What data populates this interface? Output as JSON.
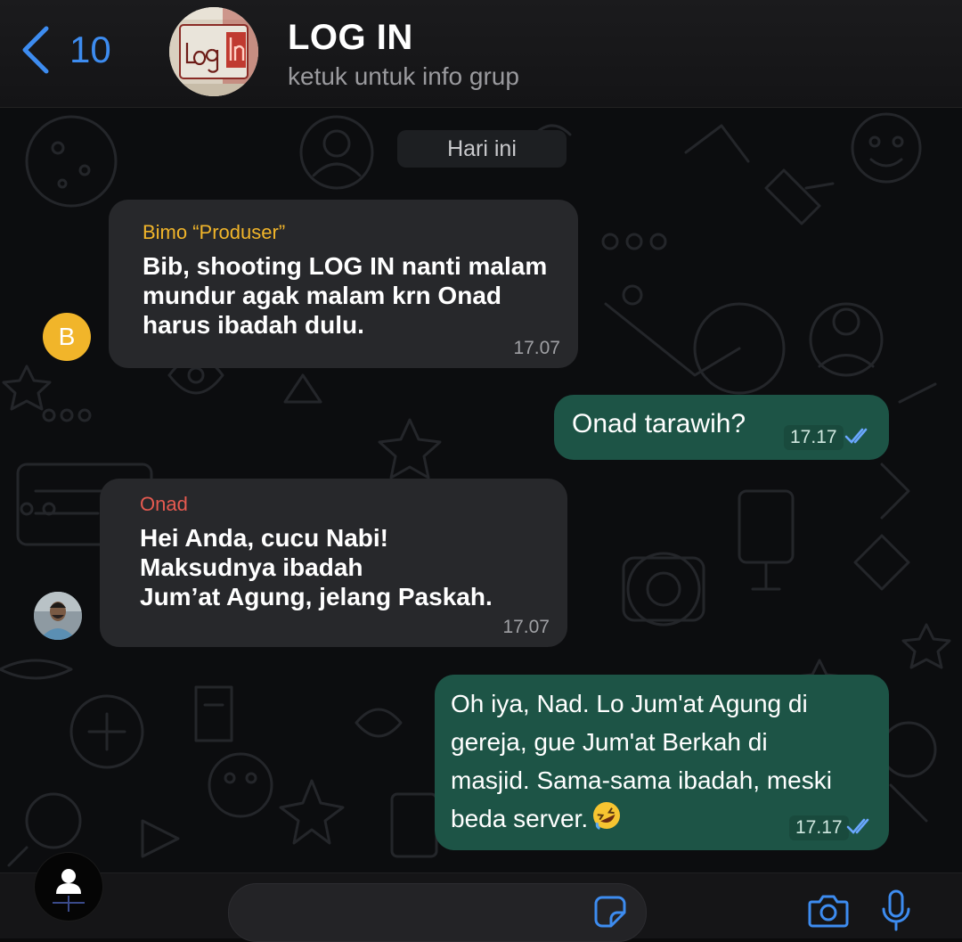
{
  "header": {
    "back_count": "10",
    "group_name": "LOG IN",
    "group_subtitle": "ketuk untuk info grup",
    "group_avatar_text": "Log In"
  },
  "chat": {
    "day_label": "Hari ini",
    "messages": [
      {
        "direction": "in",
        "sender": "Bimo “Produser”",
        "sender_color": "#f1b52a",
        "avatar_letter": "B",
        "text": "Bib, shooting LOG IN nanti malam\nmundur agak malam krn Onad\nharus ibadah dulu.",
        "time": "17.07"
      },
      {
        "direction": "out",
        "text": "Onad tarawih?",
        "time": "17.17",
        "status": "read"
      },
      {
        "direction": "in",
        "sender": "Onad",
        "sender_color": "#e65a50",
        "text": "Hei Anda, cucu Nabi!\nMaksudnya ibadah\nJum’at Agung, jelang Paskah.",
        "time": "17.07"
      },
      {
        "direction": "out",
        "text": "Oh iya, Nad. Lo Jum'at Agung di\ngereja, gue Jum'at Berkah di\nmasjid. Sama-sama ibadah, meski\nbeda server.",
        "emoji": "rolling-on-floor-laughing",
        "time": "17.17",
        "status": "read"
      }
    ]
  },
  "input": {
    "icons": [
      "sticker-icon",
      "camera-icon",
      "microphone-icon",
      "person-icon"
    ]
  },
  "colors": {
    "accent": "#3d8cf0",
    "outgoing_bubble": "#1d5446",
    "incoming_bubble": "#27282b",
    "read_ticks": "#6aa7ff"
  }
}
